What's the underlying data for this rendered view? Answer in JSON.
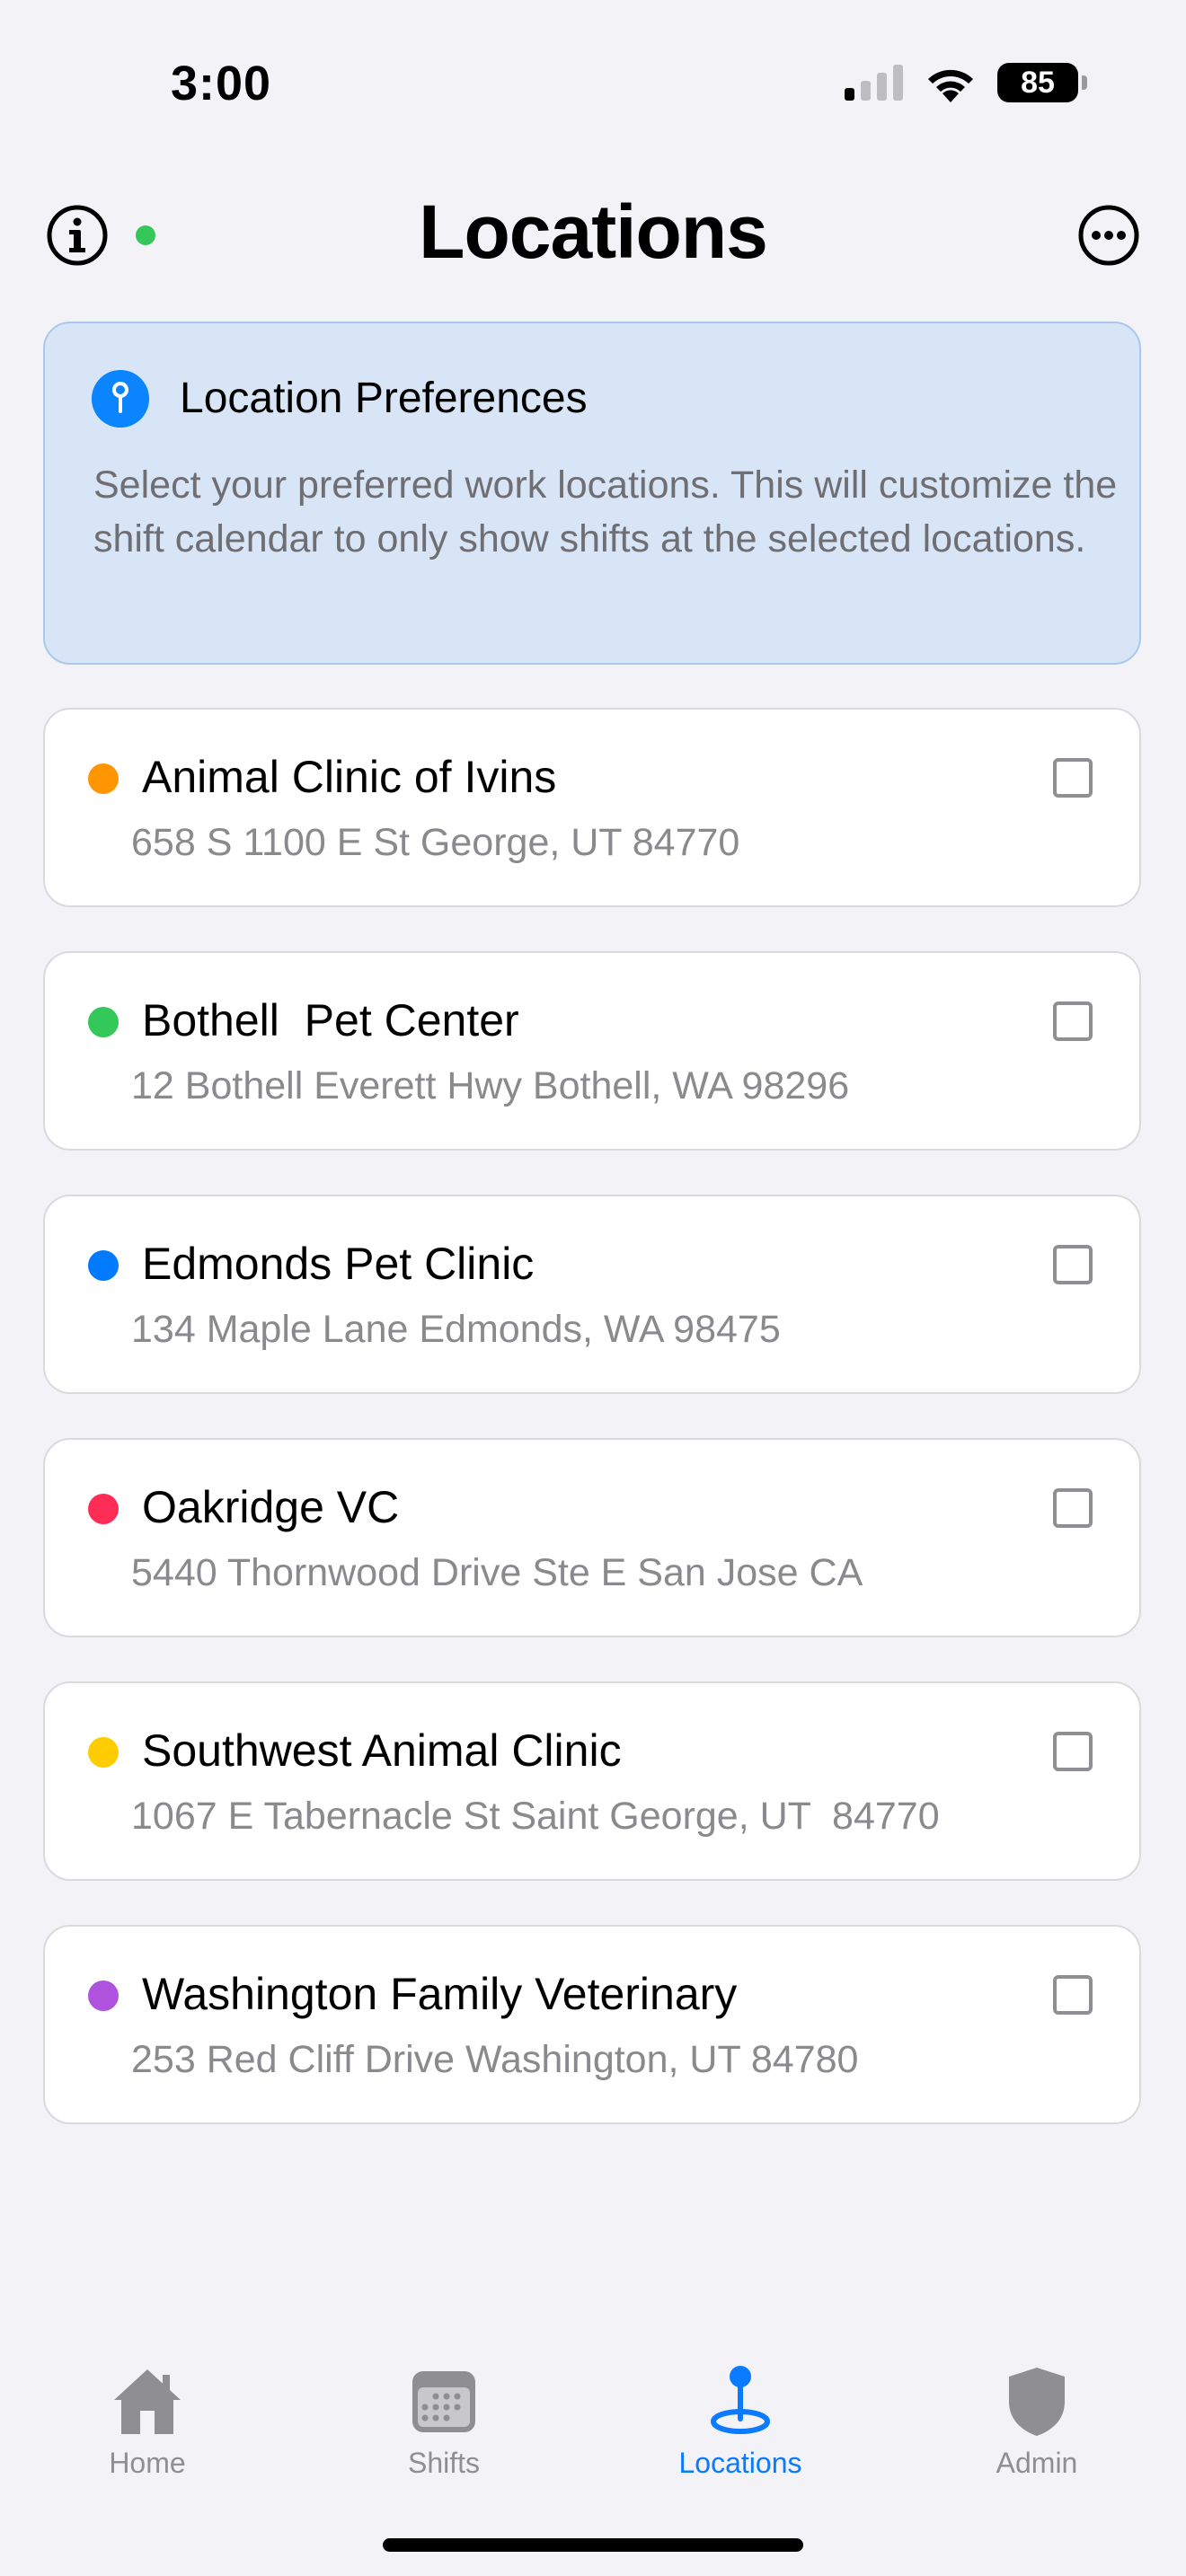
{
  "status_bar": {
    "time": "3:00",
    "battery": "85"
  },
  "header": {
    "title": "Locations"
  },
  "preferences": {
    "title": "Location Preferences",
    "body": "Select your preferred work locations. This will customize the shift calendar to only show shifts at the selected locations."
  },
  "locations": [
    {
      "name": "Animal Clinic of Ivins",
      "address": "658 S 1100 E St George, UT 84770",
      "color": "#FF9500",
      "selected": false
    },
    {
      "name": "Bothell  Pet Center",
      "address": "12 Bothell Everett Hwy Bothell, WA 98296",
      "color": "#34C759",
      "selected": false
    },
    {
      "name": "Edmonds Pet Clinic",
      "address": "134 Maple Lane Edmonds, WA 98475",
      "color": "#007AFF",
      "selected": false
    },
    {
      "name": "Oakridge VC",
      "address": "5440 Thornwood Drive Ste E San Jose CA",
      "color": "#FF2D55",
      "selected": false
    },
    {
      "name": "Southwest Animal Clinic",
      "address": "1067 E Tabernacle St Saint George, UT  84770",
      "color": "#FFCC00",
      "selected": false
    },
    {
      "name": "Washington Family Veterinary",
      "address": "253 Red Cliff Drive Washington, UT 84780",
      "color": "#AF52DE",
      "selected": false
    }
  ],
  "tabs": [
    {
      "label": "Home",
      "icon": "house-icon",
      "active": false
    },
    {
      "label": "Shifts",
      "icon": "calendar-icon",
      "active": false
    },
    {
      "label": "Locations",
      "icon": "map-pin-icon",
      "active": true
    },
    {
      "label": "Admin",
      "icon": "shield-icon",
      "active": false
    }
  ]
}
